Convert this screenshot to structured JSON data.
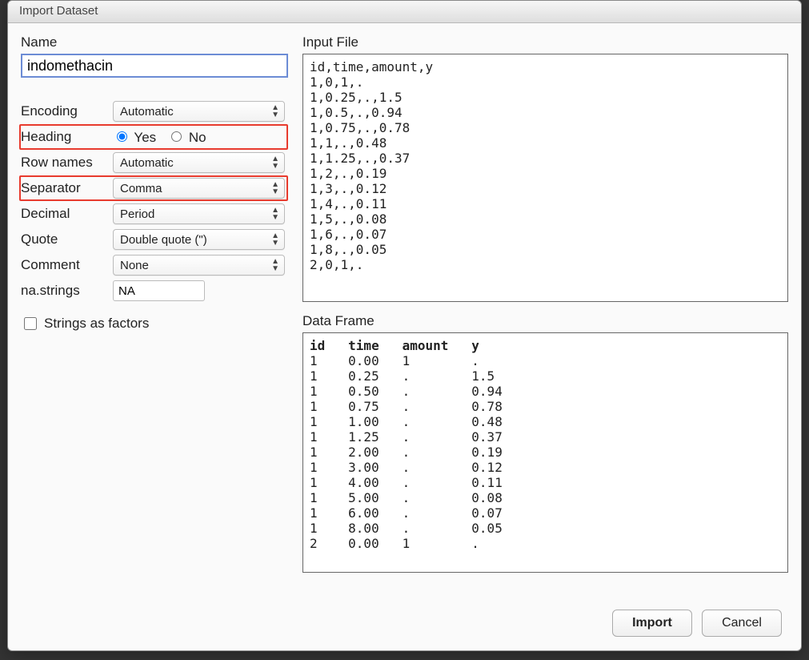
{
  "title": "Import Dataset",
  "left": {
    "name_label": "Name",
    "name_value": "indomethacin",
    "encoding_label": "Encoding",
    "encoding_value": "Automatic",
    "heading_label": "Heading",
    "heading_yes": "Yes",
    "heading_no": "No",
    "heading_selected": "yes",
    "rownames_label": "Row names",
    "rownames_value": "Automatic",
    "separator_label": "Separator",
    "separator_value": "Comma",
    "decimal_label": "Decimal",
    "decimal_value": "Period",
    "quote_label": "Quote",
    "quote_value": "Double quote (\")",
    "comment_label": "Comment",
    "comment_value": "None",
    "nastrings_label": "na.strings",
    "nastrings_value": "NA",
    "strings_as_factors_label": "Strings as factors",
    "strings_as_factors_checked": false
  },
  "right": {
    "inputfile_label": "Input File",
    "dataframe_label": "Data Frame",
    "inputfile_text": "id,time,amount,y\n1,0,1,.\n1,0.25,.,1.5\n1,0.5,.,0.94\n1,0.75,.,0.78\n1,1,.,0.48\n1,1.25,.,0.37\n1,2,.,0.19\n1,3,.,0.12\n1,4,.,0.11\n1,5,.,0.08\n1,6,.,0.07\n1,8,.,0.05\n2,0,1,.",
    "dataframe_header": [
      "id",
      "time",
      "amount",
      "y"
    ],
    "dataframe_rows": [
      [
        "1",
        "0.00",
        "1",
        "."
      ],
      [
        "1",
        "0.25",
        ".",
        "1.5"
      ],
      [
        "1",
        "0.50",
        ".",
        "0.94"
      ],
      [
        "1",
        "0.75",
        ".",
        "0.78"
      ],
      [
        "1",
        "1.00",
        ".",
        "0.48"
      ],
      [
        "1",
        "1.25",
        ".",
        "0.37"
      ],
      [
        "1",
        "2.00",
        ".",
        "0.19"
      ],
      [
        "1",
        "3.00",
        ".",
        "0.12"
      ],
      [
        "1",
        "4.00",
        ".",
        "0.11"
      ],
      [
        "1",
        "5.00",
        ".",
        "0.08"
      ],
      [
        "1",
        "6.00",
        ".",
        "0.07"
      ],
      [
        "1",
        "8.00",
        ".",
        "0.05"
      ],
      [
        "2",
        "0.00",
        "1",
        "."
      ]
    ]
  },
  "buttons": {
    "import": "Import",
    "cancel": "Cancel"
  }
}
